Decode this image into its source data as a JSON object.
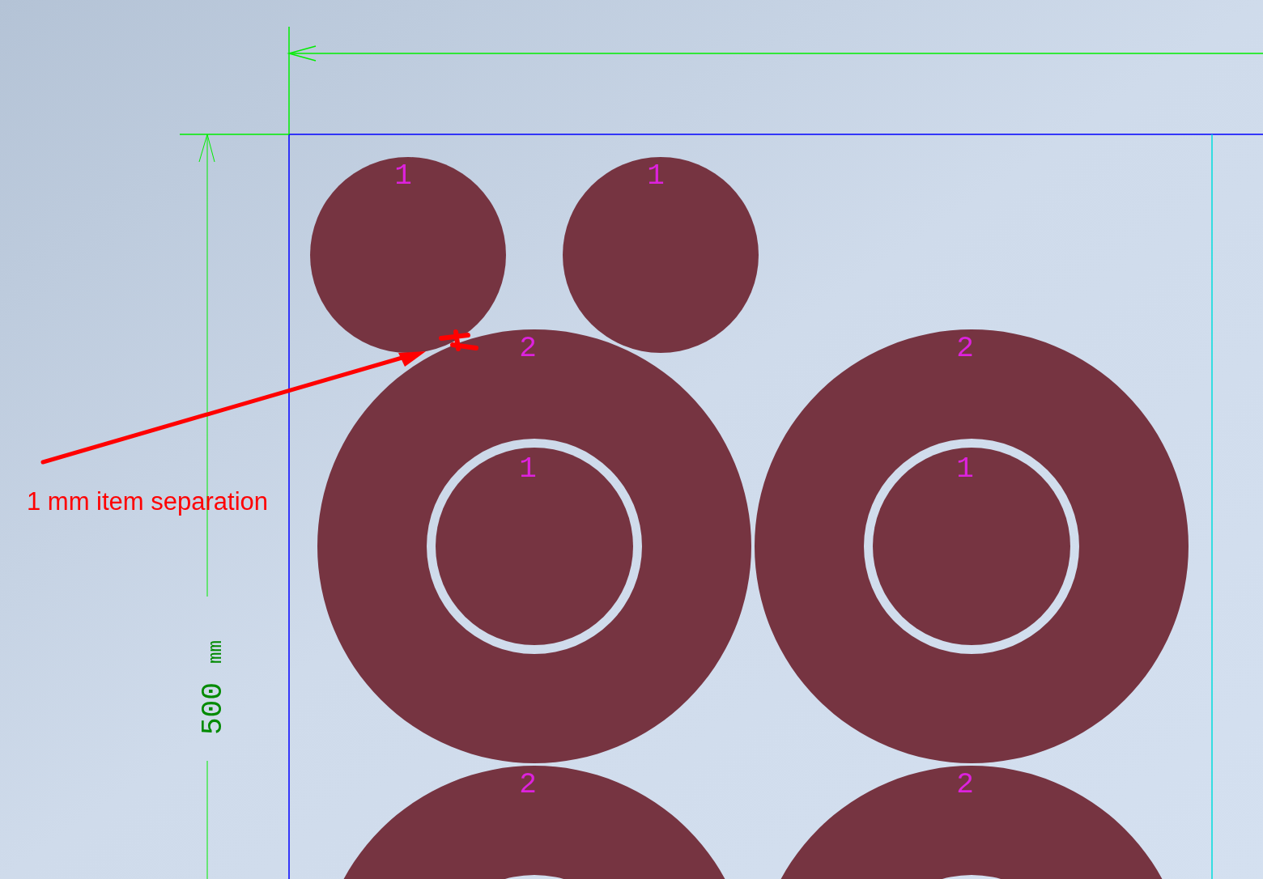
{
  "dimensions": {
    "vertical": {
      "value": "500",
      "unit": "mm"
    }
  },
  "parts": [
    {
      "kind": "disc",
      "label": "1"
    },
    {
      "kind": "disc",
      "label": "1"
    },
    {
      "kind": "ring",
      "label": "2",
      "inner": {
        "label": "1"
      }
    },
    {
      "kind": "ring",
      "label": "2",
      "inner": {
        "label": "1"
      }
    },
    {
      "kind": "ring",
      "label": "2"
    },
    {
      "kind": "ring",
      "label": "2"
    }
  ],
  "annotation": {
    "text": "1 mm item separation"
  }
}
